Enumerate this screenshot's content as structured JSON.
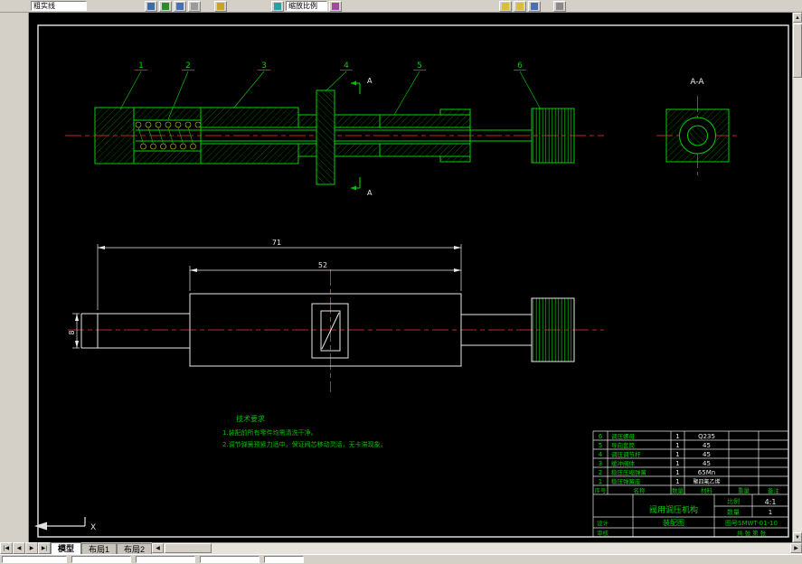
{
  "toolbar": {
    "layer_value": "粗实线",
    "zoom_value": "缩放比例"
  },
  "tabs": {
    "model": "模型",
    "layout1": "布局1",
    "layout2": "布局2"
  },
  "drawing": {
    "balloons": [
      "1",
      "2",
      "3",
      "4",
      "5",
      "6"
    ],
    "section_label": "A-A",
    "cut_label_top": "A",
    "cut_label_bottom": "A",
    "dims": {
      "overall": "71",
      "body": "52",
      "shaft": "8"
    },
    "notes": {
      "title": "技术要求",
      "line1": "1.装配前所有零件均需清洗干净。",
      "line2": "2.调节弹簧预紧力适中，保证阀芯移动灵活，无卡滞现象。"
    },
    "ucs_x": "X",
    "parts_header": {
      "no": "序号",
      "name": "名称",
      "qty": "数量",
      "material": "材料",
      "weight": "重量",
      "remark": "备注"
    },
    "parts": [
      {
        "no": "6",
        "name": "调压螺母",
        "qty": "1",
        "material": "Q235"
      },
      {
        "no": "5",
        "name": "导向套筒",
        "qty": "1",
        "material": "45"
      },
      {
        "no": "4",
        "name": "调压调节杆",
        "qty": "1",
        "material": "45"
      },
      {
        "no": "3",
        "name": "缓冲阀体",
        "qty": "1",
        "material": "45"
      },
      {
        "no": "2",
        "name": "稳压压缩弹簧",
        "qty": "1",
        "material": "65Mn"
      },
      {
        "no": "1",
        "name": "稳压弹簧座",
        "qty": "1",
        "material": "聚四氟乙烯"
      }
    ],
    "title_block": {
      "title_line1": "阀用调压机构",
      "title_line2": "装配图",
      "scale_label": "比例",
      "scale": "4:1",
      "qty_label": "数量",
      "qty": "1",
      "drawing_no": "图号SMWT-01-10",
      "sheet": "共 张 第 张",
      "designer": "设计",
      "checker": "审核"
    },
    "colors": {
      "line_green": "#00d000",
      "hatch_green": "#00a000",
      "centerline_red": "#ff3333",
      "dim_white": "#e8e8e8",
      "spring_yellow": "#cccc00"
    }
  }
}
